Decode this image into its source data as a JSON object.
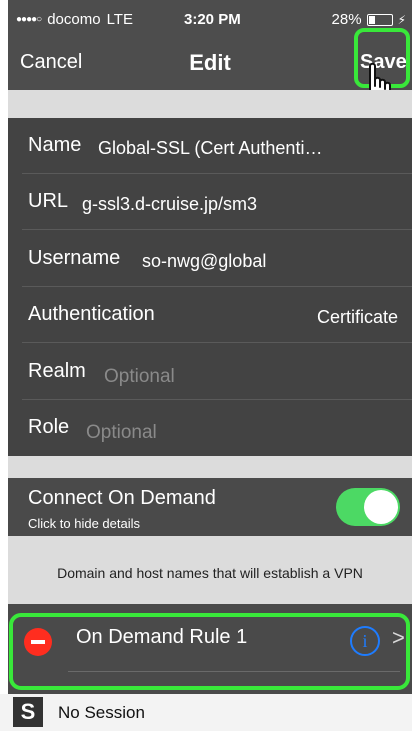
{
  "status_bar": {
    "carrier": "docomo",
    "network": "LTE",
    "time": "3:20 PM",
    "battery_text": "28%",
    "battery_level": 0.28,
    "signal_dots": "●●●●○"
  },
  "nav": {
    "cancel_label": "Cancel",
    "title": "Edit",
    "save_label": "Save"
  },
  "form": {
    "name_label": "Name",
    "name_value": "Global-SSL (Cert Authenti…",
    "url_label": "URL",
    "url_value": "g-ssl3.d-cruise.jp/sm3",
    "username_label": "Username",
    "username_value": "so-nwg@global",
    "auth_label": "Authentication",
    "auth_value": "Certificate",
    "realm_label": "Realm",
    "realm_placeholder": "Optional",
    "role_label": "Role",
    "role_placeholder": "Optional"
  },
  "on_demand": {
    "title": "Connect On Demand",
    "subtitle": "Click to hide details",
    "enabled": true,
    "note": "Domain and host names that will establish a VPN",
    "rule_label": "On Demand Rule 1"
  },
  "footer": {
    "logo_glyph": "S",
    "session_text": "No Session"
  },
  "colors": {
    "highlight": "#39e83a",
    "toggle_on": "#4cd964",
    "delete_red": "#ff2d1f",
    "info_blue": "#1e7cff",
    "dark_bg": "#434343"
  }
}
